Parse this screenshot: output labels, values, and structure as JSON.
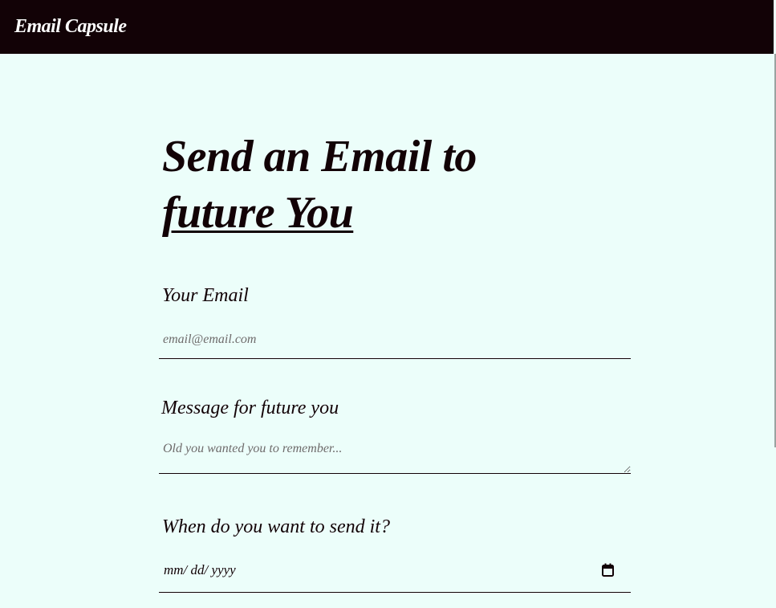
{
  "app": {
    "brand": "Email Capsule"
  },
  "hero": {
    "line1": "Send an Email to",
    "line2": "future You"
  },
  "form": {
    "email_label": "Your Email",
    "email_placeholder": "email@email.com",
    "email_value": "",
    "message_label": "Message for future you",
    "message_placeholder": "Old you wanted you to remember...",
    "message_value": "",
    "date_label": "When do you want to send it?",
    "date_placeholder": "mm/ dd/ yyyy",
    "date_icon": "calendar-icon"
  },
  "colors": {
    "navbar_bg": "#120206",
    "page_bg": "#ecfefa",
    "text": "#120206",
    "brand_text": "#ffffff"
  }
}
